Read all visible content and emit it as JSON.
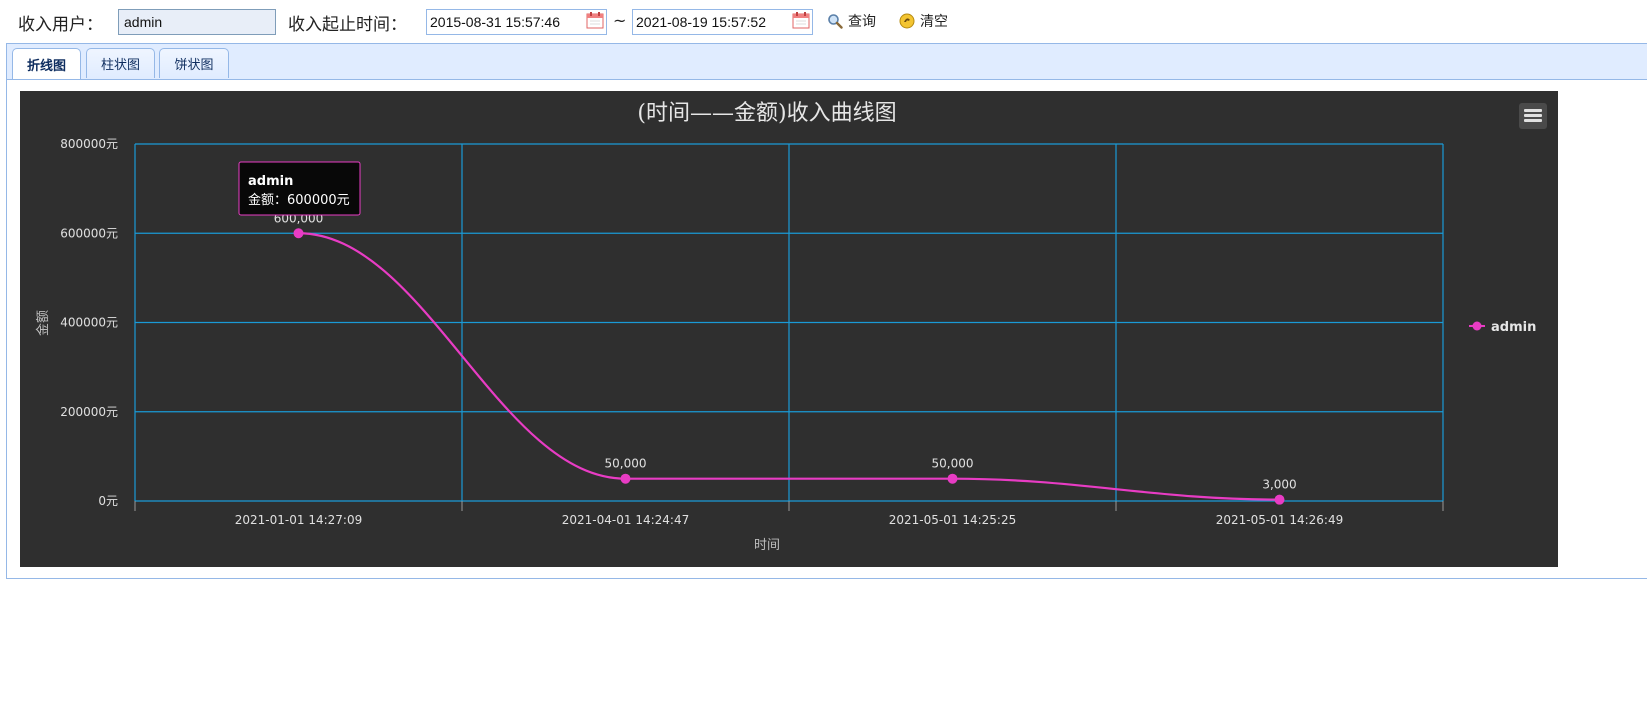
{
  "filter": {
    "user_label": "收入用户：",
    "user_value": "admin",
    "time_label": "收入起止时间：",
    "start_date": "2015-08-31 15:57:46",
    "end_date": "2021-08-19 15:57:52",
    "separator": "~",
    "query_label": "查询",
    "clear_label": "清空"
  },
  "tabs": [
    {
      "label": "折线图",
      "active": true
    },
    {
      "label": "柱状图",
      "active": false
    },
    {
      "label": "饼状图",
      "active": false
    }
  ],
  "tooltip": {
    "series": "admin",
    "text": "金额：600000元"
  },
  "colors": {
    "series": "#e83cc4",
    "grid": "#1a9ad6",
    "chart_bg": "#2f2f2f"
  },
  "chart_data": {
    "type": "line",
    "title": "(时间——金额)收入曲线图",
    "xlabel": "时间",
    "ylabel": "金额",
    "categories": [
      "2021-01-01 14:27:09",
      "2021-04-01 14:24:47",
      "2021-05-01 14:25:25",
      "2021-05-01 14:26:49"
    ],
    "series": [
      {
        "name": "admin",
        "values": [
          600000,
          50000,
          50000,
          3000
        ],
        "labels": [
          "600,000",
          "50,000",
          "50,000",
          "3,000"
        ]
      }
    ],
    "y_ticks": [
      "0元",
      "200000元",
      "400000元",
      "600000元",
      "800000元"
    ],
    "ylim": [
      0,
      800000
    ],
    "grid": true,
    "legend_position": "right"
  }
}
